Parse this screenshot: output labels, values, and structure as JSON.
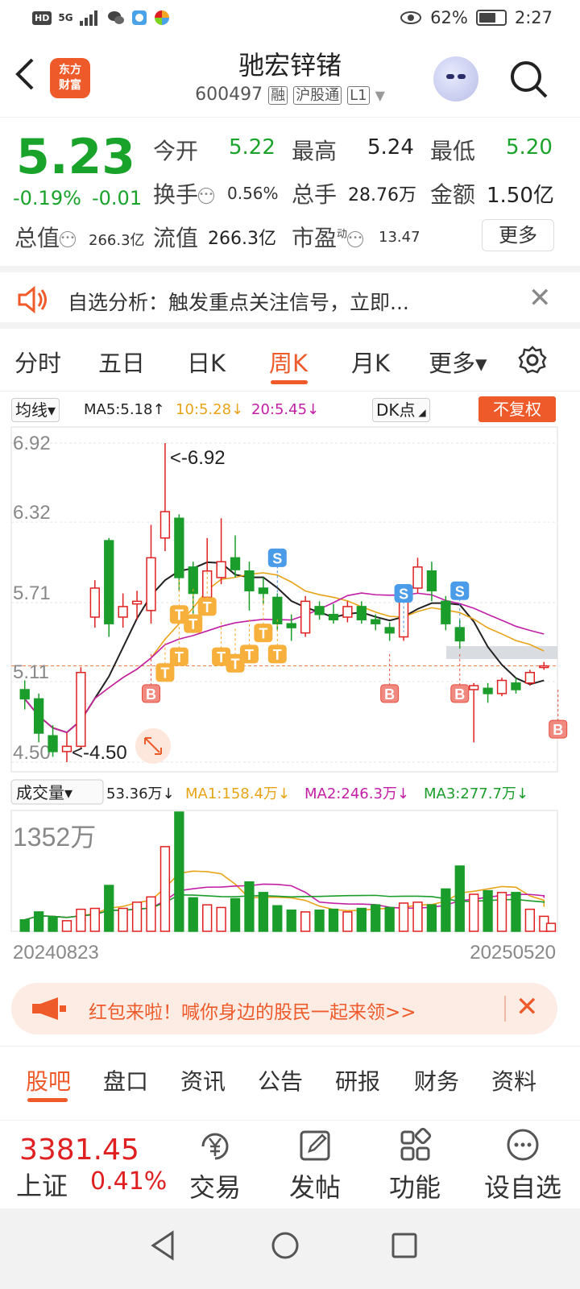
{
  "status_bar": {
    "network": "5G",
    "battery": "62%",
    "time": "2:27"
  },
  "header": {
    "back_icon": "back-arrow-icon",
    "logo_text_top": "东方",
    "logo_text_bottom": "财富",
    "stock_name": "驰宏锌锗",
    "stock_code": "600497",
    "tag_margin": "融",
    "tag_connect": "沪股通",
    "tag_level": "L1"
  },
  "quote": {
    "price": "5.23",
    "change_pct": "-0.19%",
    "change": "-0.01",
    "open_label": "今开",
    "open": "5.22",
    "high_label": "最高",
    "high": "5.24",
    "low_label": "最低",
    "low": "5.20",
    "turnover_label": "换手",
    "turnover": "0.56%",
    "volume_label": "总手",
    "volume": "28.76万",
    "amount_label": "金额",
    "amount": "1.50亿",
    "total_cap_label": "总值",
    "total_cap": "266.3亿",
    "float_cap_label": "流值",
    "float_cap": "266.3亿",
    "pe_label": "市盈",
    "pe_sup": "动",
    "pe": "13.47",
    "more_label": "更多"
  },
  "notice": {
    "text": "自选分析：触发重点关注信号，立即..."
  },
  "tabs": [
    {
      "label": "分时"
    },
    {
      "label": "五日"
    },
    {
      "label": "日K"
    },
    {
      "label": "周K"
    },
    {
      "label": "月K"
    },
    {
      "label": "更多▾"
    }
  ],
  "ma_bar": {
    "selector": "均线▾",
    "ma5": "MA5:5.18↑",
    "ma10": "10:5.28↓",
    "ma20": "20:5.45↓",
    "dk": "DK点",
    "fq": "不复权",
    "ma5_color": "#222222",
    "ma10_color": "#e8a317",
    "ma20_color": "#c21fa5"
  },
  "vol_bar": {
    "selector": "成交量▾",
    "vol": "53.36万↓",
    "ma1": "MA1:158.4万↓",
    "ma2": "MA2:246.3万↓",
    "ma3": "MA3:277.7万↓"
  },
  "chart_data": {
    "type": "candlestick",
    "y_ticks": [
      "6.92",
      "6.32",
      "5.71",
      "5.11",
      "4.50"
    ],
    "ylim": [
      4.5,
      6.92
    ],
    "max_label": "<-6.92",
    "min_label": "<-4.50",
    "volume_max_label": "1352万",
    "start_date": "20240823",
    "end_date": "20250520",
    "candles": [
      {
        "o": 5.05,
        "c": 4.98,
        "h": 5.12,
        "l": 4.9
      },
      {
        "o": 4.98,
        "c": 4.72,
        "h": 5.02,
        "l": 4.65
      },
      {
        "o": 4.7,
        "c": 4.58,
        "h": 4.78,
        "l": 4.54
      },
      {
        "o": 4.58,
        "c": 4.62,
        "h": 4.72,
        "l": 4.5
      },
      {
        "o": 4.62,
        "c": 5.18,
        "h": 5.22,
        "l": 4.6
      },
      {
        "o": 5.6,
        "c": 5.82,
        "h": 5.88,
        "l": 5.52
      },
      {
        "o": 6.18,
        "c": 5.55,
        "h": 6.2,
        "l": 5.45
      },
      {
        "o": 5.6,
        "c": 5.68,
        "h": 5.78,
        "l": 5.52
      },
      {
        "o": 5.7,
        "c": 5.72,
        "h": 5.8,
        "l": 5.58
      },
      {
        "o": 5.65,
        "c": 6.05,
        "h": 6.3,
        "l": 5.55
      },
      {
        "o": 6.2,
        "c": 6.4,
        "h": 6.92,
        "l": 6.1
      },
      {
        "o": 6.35,
        "c": 5.9,
        "h": 6.38,
        "l": 5.8
      },
      {
        "o": 5.98,
        "c": 5.78,
        "h": 6.02,
        "l": 5.55
      },
      {
        "o": 5.75,
        "c": 5.95,
        "h": 6.2,
        "l": 5.65
      },
      {
        "o": 5.9,
        "c": 6.02,
        "h": 6.35,
        "l": 5.85
      },
      {
        "o": 6.05,
        "c": 5.96,
        "h": 6.22,
        "l": 5.9
      },
      {
        "o": 5.95,
        "c": 5.8,
        "h": 6.02,
        "l": 5.65
      },
      {
        "o": 5.82,
        "c": 5.78,
        "h": 5.9,
        "l": 5.7
      },
      {
        "o": 5.75,
        "c": 5.55,
        "h": 5.78,
        "l": 5.5
      },
      {
        "o": 5.55,
        "c": 5.52,
        "h": 5.62,
        "l": 5.42
      },
      {
        "o": 5.48,
        "c": 5.72,
        "h": 5.76,
        "l": 5.45
      },
      {
        "o": 5.68,
        "c": 5.62,
        "h": 5.72,
        "l": 5.58
      },
      {
        "o": 5.62,
        "c": 5.58,
        "h": 5.7,
        "l": 5.55
      },
      {
        "o": 5.6,
        "c": 5.68,
        "h": 5.72,
        "l": 5.56
      },
      {
        "o": 5.68,
        "c": 5.58,
        "h": 5.72,
        "l": 5.55
      },
      {
        "o": 5.58,
        "c": 5.55,
        "h": 5.62,
        "l": 5.5
      },
      {
        "o": 5.52,
        "c": 5.48,
        "h": 5.56,
        "l": 5.42
      },
      {
        "o": 5.45,
        "c": 5.72,
        "h": 5.76,
        "l": 5.42
      },
      {
        "o": 5.82,
        "c": 5.98,
        "h": 6.05,
        "l": 5.78
      },
      {
        "o": 5.95,
        "c": 5.8,
        "h": 6.02,
        "l": 5.72
      },
      {
        "o": 5.72,
        "c": 5.55,
        "h": 5.76,
        "l": 5.5
      },
      {
        "o": 5.52,
        "c": 5.42,
        "h": 5.58,
        "l": 5.36
      },
      {
        "o": 5.05,
        "c": 5.08,
        "h": 5.1,
        "l": 4.65
      },
      {
        "o": 5.06,
        "c": 5.02,
        "h": 5.1,
        "l": 4.95
      },
      {
        "o": 5.02,
        "c": 5.12,
        "h": 5.14,
        "l": 5.0
      },
      {
        "o": 5.1,
        "c": 5.05,
        "h": 5.14,
        "l": 5.02
      },
      {
        "o": 5.1,
        "c": 5.18,
        "h": 5.2,
        "l": 5.08
      },
      {
        "o": 5.22,
        "c": 5.23,
        "h": 5.26,
        "l": 5.2
      }
    ],
    "volumes": [
      130,
      220,
      160,
      120,
      250,
      260,
      520,
      260,
      330,
      390,
      960,
      1352,
      380,
      300,
      270,
      370,
      560,
      440,
      290,
      240,
      220,
      240,
      250,
      220,
      260,
      300,
      270,
      320,
      330,
      300,
      480,
      740,
      420,
      460,
      440,
      440,
      250,
      170,
      90
    ],
    "buy_signals": [
      {
        "i": 9,
        "p": 5.02
      },
      {
        "i": 26,
        "p": 5.02
      },
      {
        "i": 31,
        "p": 5.02
      },
      {
        "i": 38,
        "p": 4.75
      }
    ],
    "sell_signals": [
      {
        "i": 18,
        "p": 6.05
      },
      {
        "i": 27,
        "p": 5.78
      },
      {
        "i": 31,
        "p": 5.8
      }
    ],
    "t_signals": [
      {
        "i": 10,
        "p": 5.18
      },
      {
        "i": 11,
        "p": 5.3
      },
      {
        "i": 11,
        "p": 5.62
      },
      {
        "i": 12,
        "p": 5.55
      },
      {
        "i": 13,
        "p": 5.68
      },
      {
        "i": 14,
        "p": 5.3
      },
      {
        "i": 15,
        "p": 5.25
      },
      {
        "i": 16,
        "p": 5.32
      },
      {
        "i": 17,
        "p": 5.48
      },
      {
        "i": 18,
        "p": 5.32
      }
    ],
    "signal_labels": {
      "buy": "B",
      "sell": "S",
      "t": "T"
    }
  },
  "banner": {
    "text": "红包来啦！喊你身边的股民一起来领>>"
  },
  "sub_tabs": [
    {
      "label": "股吧"
    },
    {
      "label": "盘口"
    },
    {
      "label": "资讯"
    },
    {
      "label": "公告"
    },
    {
      "label": "研报"
    },
    {
      "label": "财务"
    },
    {
      "label": "资料"
    }
  ],
  "bottom_bar": {
    "index_value": "3381.45",
    "index_name": "上证",
    "index_pct": "0.41%",
    "items": [
      {
        "label": "交易",
        "icon": "trade-yen-icon"
      },
      {
        "label": "发帖",
        "icon": "edit-post-icon"
      },
      {
        "label": "功能",
        "icon": "grid-apps-icon"
      },
      {
        "label": "设自选",
        "icon": "more-dots-icon"
      }
    ]
  }
}
